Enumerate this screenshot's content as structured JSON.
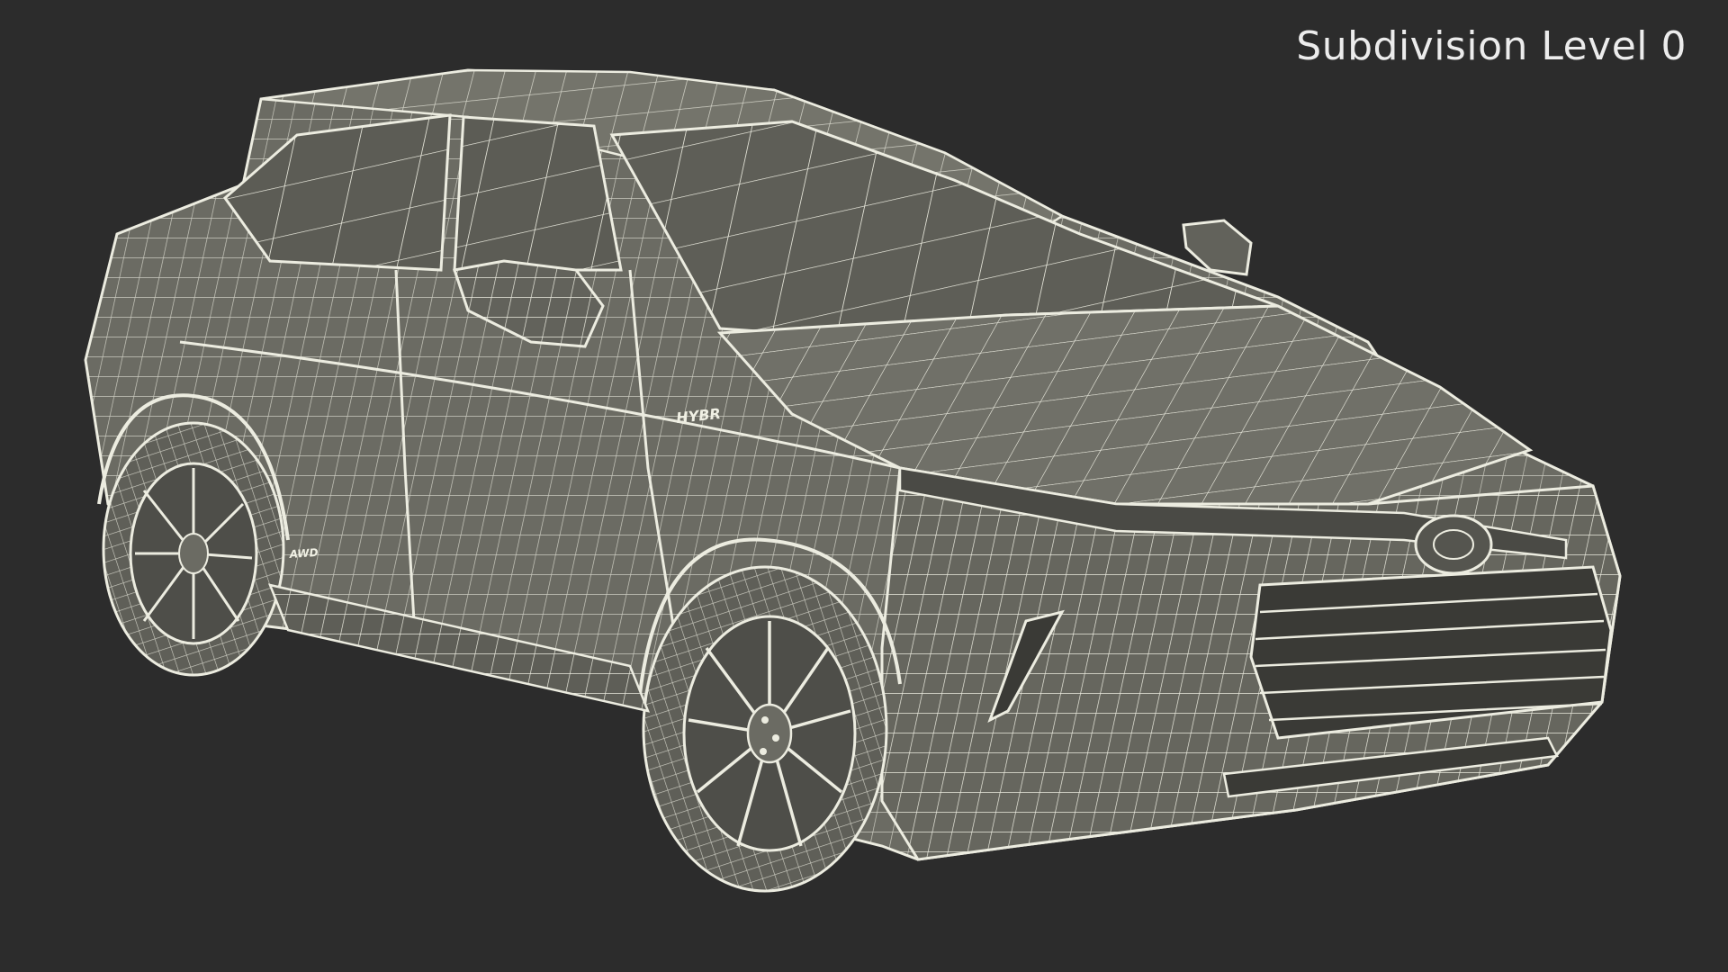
{
  "overlay": {
    "title": "Subdivision Level 0"
  },
  "car": {
    "side_badge": "HYBR",
    "rear_badge": "AWD"
  },
  "colors": {
    "background": "#2c2c2c",
    "body_fill": "#6b6b63",
    "body_shadow": "#55554f",
    "wire": "#ecece0",
    "dark_trim": "#3a3a36"
  }
}
